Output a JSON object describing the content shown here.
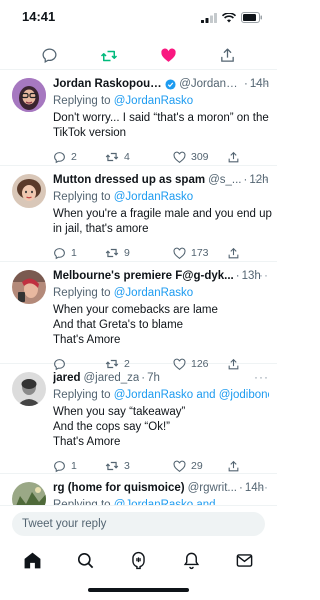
{
  "status_bar": {
    "time": "14:41"
  },
  "actions": {
    "icons": [
      "reply-icon",
      "retweet-icon",
      "like-icon",
      "share-icon"
    ],
    "retweet_color": "#00ba7c",
    "like_color": "#f91880"
  },
  "tweets": [
    {
      "name": "Jordan Raskopoulos",
      "verified": true,
      "handle": "@JordanR...",
      "time": "14h",
      "replying_prefix": "Replying to",
      "replying_to": "@JordanRasko",
      "text": [
        "Don't worry... I said “that's a moron” on the",
        "TikTok version"
      ],
      "replies": "2",
      "retweets": "4",
      "likes": "309"
    },
    {
      "name": "Mutton dressed up as spam",
      "verified": false,
      "handle": "@s_...",
      "time": "12h",
      "replying_prefix": "Replying to",
      "replying_to": "@JordanRasko",
      "text": [
        "When you're a fragile male and you end up",
        "in jail, that's amore"
      ],
      "replies": "1",
      "retweets": "9",
      "likes": "173"
    },
    {
      "name": "Melbourne's premiere F@g-dyk...",
      "verified": false,
      "handle": "",
      "time": "13h",
      "replying_prefix": "Replying to",
      "replying_to": "@JordanRasko",
      "text": [
        "When your comebacks are lame",
        "And that Greta's to blame",
        "That's Amore"
      ],
      "replies": "",
      "retweets": "2",
      "likes": "126"
    },
    {
      "name": "jared",
      "verified": false,
      "handle": "@jared_za",
      "time": "7h",
      "replying_prefix": "Replying to",
      "replying_to": "@JordanRasko and @jodiboner_",
      "text": [
        "When you say “takeaway”",
        "And the cops say “Ok!”",
        "That's Amore"
      ],
      "replies": "1",
      "retweets": "3",
      "likes": "29"
    },
    {
      "name": "rg (home for quismoice)",
      "verified": false,
      "handle": "@rgwrit...",
      "time": "14h",
      "replying_prefix": "Replying to",
      "replying_to": "@JordanRasko and",
      "text": [],
      "replies": "",
      "retweets": "",
      "likes": ""
    }
  ],
  "reply_bar": {
    "placeholder": "Tweet your reply"
  },
  "tab_bar": {
    "icons": [
      "home-icon",
      "search-icon",
      "spaces-icon",
      "notifications-icon",
      "messages-icon"
    ]
  },
  "colors": {
    "link": "#1d9bf0",
    "verified": "#1d9bf0",
    "secondary_text": "#536471"
  }
}
